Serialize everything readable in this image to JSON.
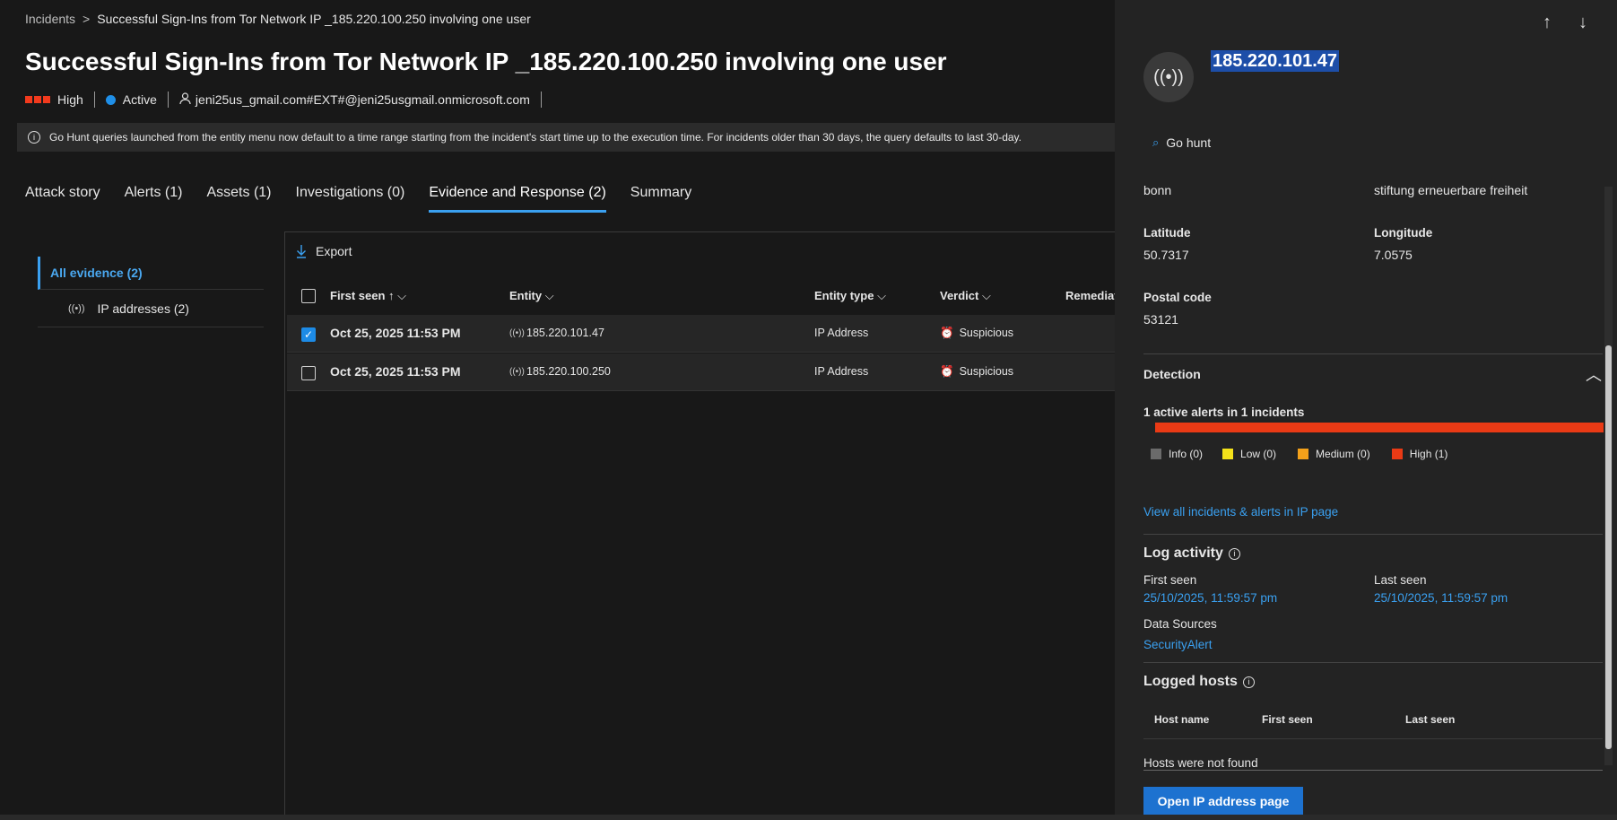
{
  "breadcrumb": {
    "root": "Incidents",
    "separator": ">",
    "current": "Successful Sign-Ins from Tor Network IP _185.220.100.250 involving one user"
  },
  "incident": {
    "title": "Successful Sign-Ins from Tor Network IP _185.220.100.250 involving one user",
    "severity": "High",
    "status": "Active",
    "user": "jeni25us_gmail.com#EXT#@jeni25usgmail.onmicrosoft.com",
    "colors": {
      "severity": "#f23a1d",
      "status": "#1f8fe8"
    }
  },
  "info_banner": "Go Hunt queries launched from the entity menu now default to a time range starting from the incident's start time up to the execution time. For incidents older than 30 days, the query defaults to last 30-day.",
  "tabs": [
    "Attack story",
    "Alerts (1)",
    "Assets (1)",
    "Investigations (0)",
    "Evidence and Response (2)",
    "Summary"
  ],
  "active_tab": "Evidence and Response (2)",
  "sidenav": {
    "all": "All evidence (2)",
    "ip": "IP addresses (2)"
  },
  "toolbar": {
    "export": "Export"
  },
  "table": {
    "columns": [
      "First seen",
      "Entity",
      "Entity type",
      "Verdict",
      "Remediati"
    ],
    "rows": [
      {
        "first_seen": "Oct 25, 2025 11:53 PM",
        "entity": "185.220.101.47",
        "type": "IP Address",
        "verdict": "Suspicious",
        "checked": true
      },
      {
        "first_seen": "Oct 25, 2025 11:53 PM",
        "entity": "185.220.100.250",
        "type": "IP Address",
        "verdict": "Suspicious",
        "checked": false
      }
    ]
  },
  "panel": {
    "ip": "185.220.101.47",
    "go_hunt": "Go hunt",
    "city": "bonn",
    "org": "stiftung erneuerbare freiheit",
    "latitude_label": "Latitude",
    "latitude": "50.7317",
    "longitude_label": "Longitude",
    "longitude": "7.0575",
    "postal_label": "Postal code",
    "postal": "53121",
    "detection_label": "Detection",
    "alerts_summary": "1 active alerts in 1 incidents",
    "legend": {
      "info": "Info (0)",
      "low": "Low (0)",
      "medium": "Medium (0)",
      "high": "High (1)"
    },
    "legend_colors": {
      "info": "#6b6b6b",
      "low": "#f4e21a",
      "medium": "#f4a11a",
      "high": "#ea3a15"
    },
    "view_all": "View all incidents & alerts in IP page",
    "log_activity": "Log activity",
    "first_seen_label": "First seen",
    "first_seen": "25/10/2025, 11:59:57 pm",
    "last_seen_label": "Last seen",
    "last_seen": "25/10/2025, 11:59:57 pm",
    "data_sources_label": "Data Sources",
    "data_source": "SecurityAlert",
    "logged_hosts": "Logged hosts",
    "hosts_columns": [
      "Host name",
      "First seen",
      "Last seen"
    ],
    "hosts_empty": "Hosts were not found",
    "open_button": "Open IP address page"
  }
}
